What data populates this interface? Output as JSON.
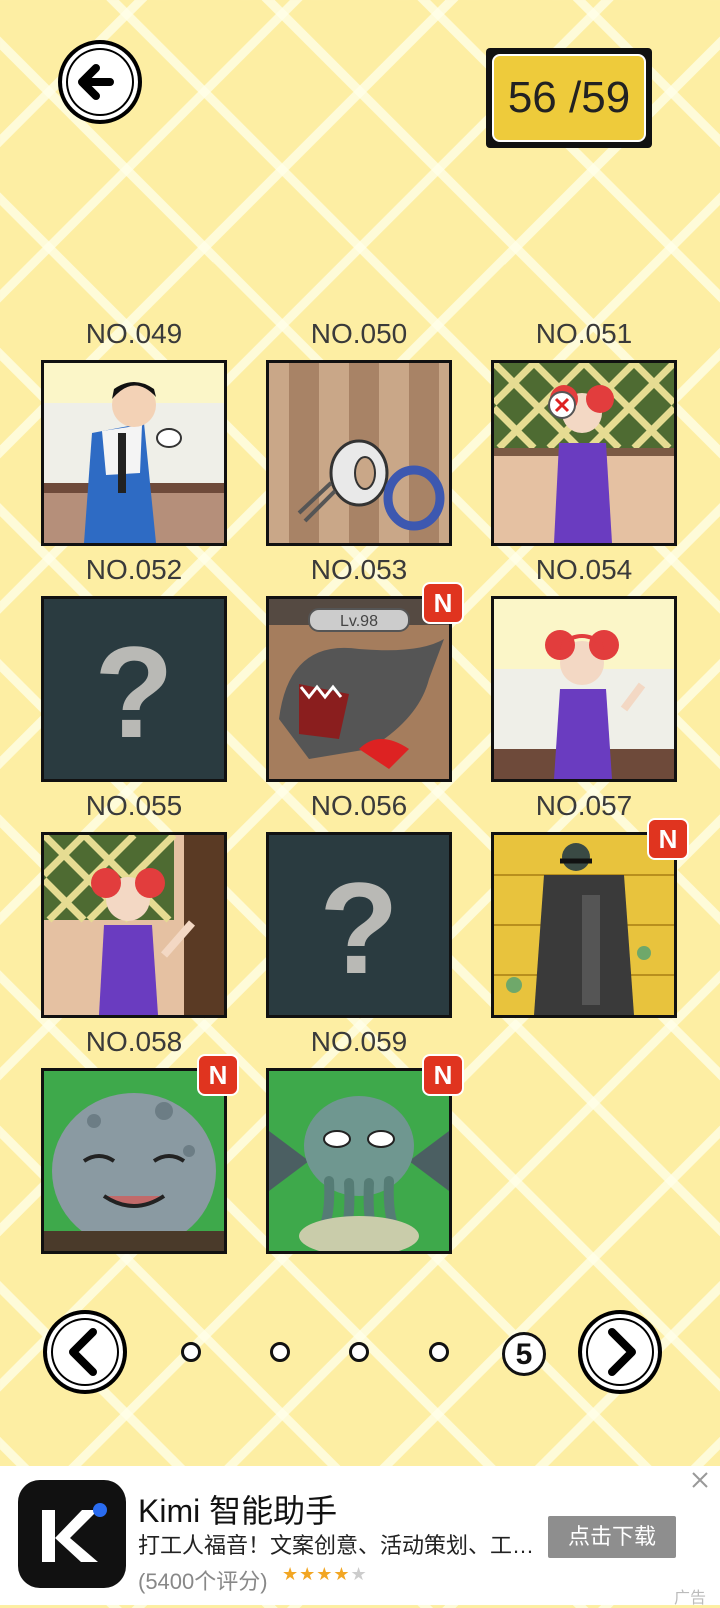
{
  "header": {
    "back_icon": "arrow-left-icon",
    "progress_text": "56 /59",
    "unlocked": 56,
    "total": 59
  },
  "gallery": {
    "items": [
      {
        "label": "NO.049",
        "locked": false,
        "is_new": false,
        "art": "boy in tracksuit kneeling"
      },
      {
        "label": "NO.050",
        "locked": false,
        "is_new": false,
        "art": "hand mixer and ring"
      },
      {
        "label": "NO.051",
        "locked": false,
        "is_new": false,
        "art": "girl with VR headset"
      },
      {
        "label": "NO.052",
        "locked": true,
        "is_new": false,
        "art": "question-mark"
      },
      {
        "label": "NO.053",
        "locked": false,
        "is_new": true,
        "art": "shark monster Lv.98"
      },
      {
        "label": "NO.054",
        "locked": false,
        "is_new": false,
        "art": "red-haired girl"
      },
      {
        "label": "NO.055",
        "locked": false,
        "is_new": false,
        "art": "red-haired girl at bamboo"
      },
      {
        "label": "NO.056",
        "locked": true,
        "is_new": false,
        "art": "question-mark"
      },
      {
        "label": "NO.057",
        "locked": false,
        "is_new": true,
        "art": "cloaked figure"
      },
      {
        "label": "NO.058",
        "locked": false,
        "is_new": true,
        "art": "octopus creature"
      },
      {
        "label": "NO.059",
        "locked": false,
        "is_new": true,
        "art": "cthulhu creature"
      }
    ],
    "new_badge": "N",
    "lv_text": "Lv.98"
  },
  "pagination": {
    "current_page": "5",
    "page_count": 5,
    "prev_icon": "chevron-left-icon",
    "next_icon": "chevron-right-icon"
  },
  "ad": {
    "title": "Kimi 智能助手",
    "description": "打工人福音！文案创意、活动策划、工…",
    "rating_text": "(5400个评分)",
    "stars_filled": 4,
    "stars_total": 5,
    "button_label": "点击下载",
    "ad_tag": "广告",
    "close_icon": "close-icon"
  },
  "colors": {
    "background": "#fdeea3",
    "counter_fill": "#eecb3b",
    "badge": "#e0341f",
    "locked_tile": "#2a3b40"
  }
}
